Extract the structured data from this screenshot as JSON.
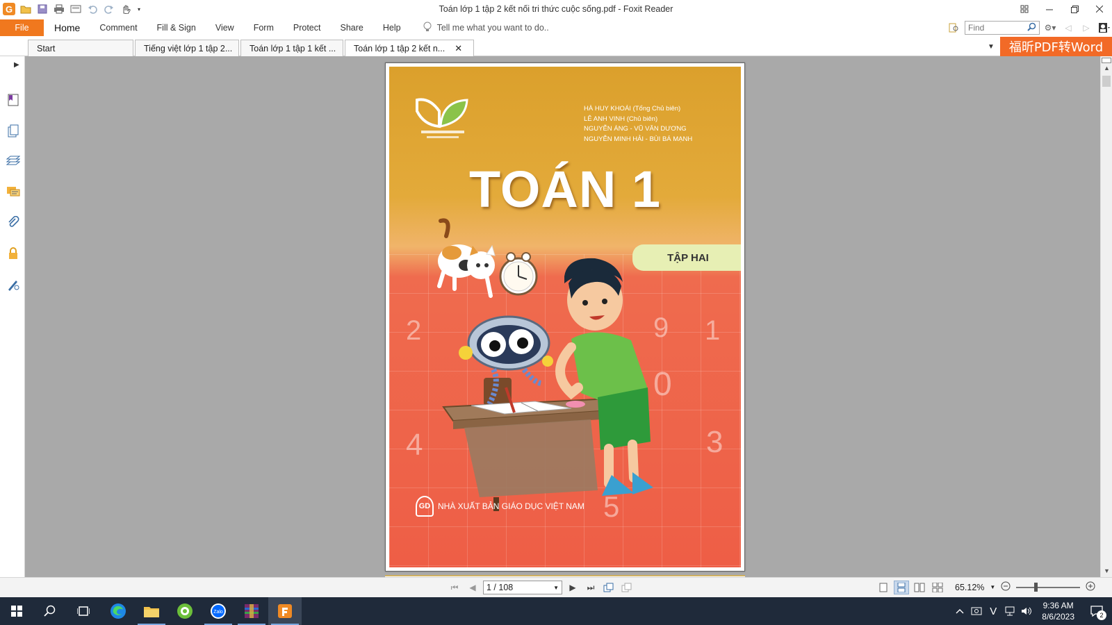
{
  "window": {
    "title": "Toán lớp 1 tập 2 kết nối tri thức cuộc sống.pdf - Foxit Reader",
    "app_logo": "G"
  },
  "ribbon": {
    "file_label": "File",
    "tabs": [
      {
        "label": "Home"
      },
      {
        "label": "Comment"
      },
      {
        "label": "Fill & Sign"
      },
      {
        "label": "View"
      },
      {
        "label": "Form"
      },
      {
        "label": "Protect"
      },
      {
        "label": "Share"
      },
      {
        "label": "Help"
      }
    ],
    "tell_me_placeholder": "Tell me what you want to do..",
    "find_placeholder": "Find"
  },
  "doc_tabs": [
    {
      "label": "Start"
    },
    {
      "label": "Tiếng việt lớp 1 tập 2..."
    },
    {
      "label": "Toán lớp 1 tập 1 kết ..."
    },
    {
      "label": "Toán lớp 1 tập 2 kết n...",
      "active": true
    }
  ],
  "promo_label": "福昕PDF转Word",
  "cover": {
    "authors": [
      "HÀ HUY KHOÁI (Tổng Chủ biên)",
      "LÊ ANH VINH (Chủ biên)",
      "NGUYỄN ÁNG - VŨ VĂN DƯƠNG",
      "NGUYỄN MINH HẢI - BÙI BÁ MẠNH"
    ],
    "title": "TOÁN 1",
    "volume": "TẬP HAI",
    "publisher": "NHÀ XUẤT BẢN GIÁO DỤC VIỆT NAM",
    "publisher_logo": "GD",
    "grid_numbers": [
      "2",
      "9",
      "1",
      "0",
      "4",
      "3",
      "5"
    ]
  },
  "statusbar": {
    "page_display": "1 / 108",
    "zoom": "65.12%"
  },
  "taskbar": {
    "time": "9:36 AM",
    "date": "8/6/2023",
    "notifications": "2"
  }
}
